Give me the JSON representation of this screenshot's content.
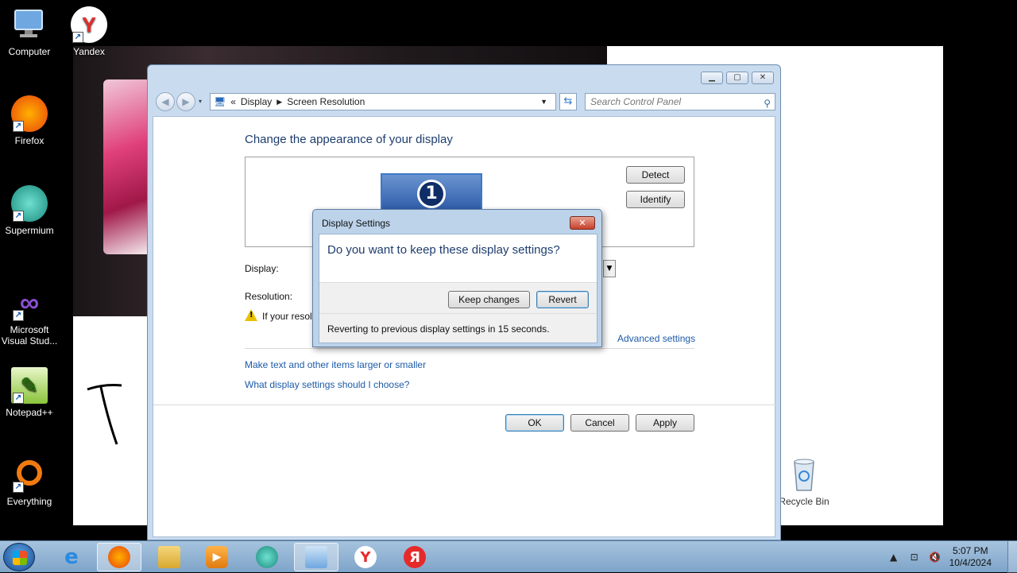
{
  "desktop": {
    "icons": [
      {
        "label": "Computer",
        "glyph": "🖥"
      },
      {
        "label": "Yandex",
        "glyph": "Y"
      },
      {
        "label": "Firefox",
        "glyph": "🦊"
      },
      {
        "label": "Supermium",
        "glyph": "●"
      },
      {
        "label": "Microsoft Visual Stud...",
        "glyph": "∞"
      },
      {
        "label": "Notepad++",
        "glyph": "✎"
      },
      {
        "label": "Everything",
        "glyph": "○"
      },
      {
        "label": "Recycle Bin",
        "glyph": "🗑"
      }
    ]
  },
  "window": {
    "breadcrumb": {
      "prefix": "«",
      "items": [
        "Display",
        "Screen Resolution"
      ]
    },
    "search_placeholder": "Search Control Panel",
    "heading": "Change the appearance of your display",
    "monitor_number": "1",
    "detect_label": "Detect",
    "identify_label": "Identify",
    "display_label": "Display:",
    "resolution_label": "Resolution:",
    "warning_text": "If your resol",
    "advanced_link": "Advanced settings",
    "link_text_size": "Make text and other items larger or smaller",
    "link_help": "What display settings should I choose?",
    "ok_label": "OK",
    "cancel_label": "Cancel",
    "apply_label": "Apply"
  },
  "dialog": {
    "title": "Display Settings",
    "question": "Do you want to keep these display settings?",
    "keep_label": "Keep changes",
    "revert_label": "Revert",
    "countdown": "Reverting to previous display settings in 15 seconds."
  },
  "taskbar": {
    "time": "5:07 PM",
    "date": "10/4/2024"
  },
  "colors": {
    "accent": "#1e3d6e",
    "link": "#1c5aa8",
    "taskbar": "#8fb2d4"
  }
}
